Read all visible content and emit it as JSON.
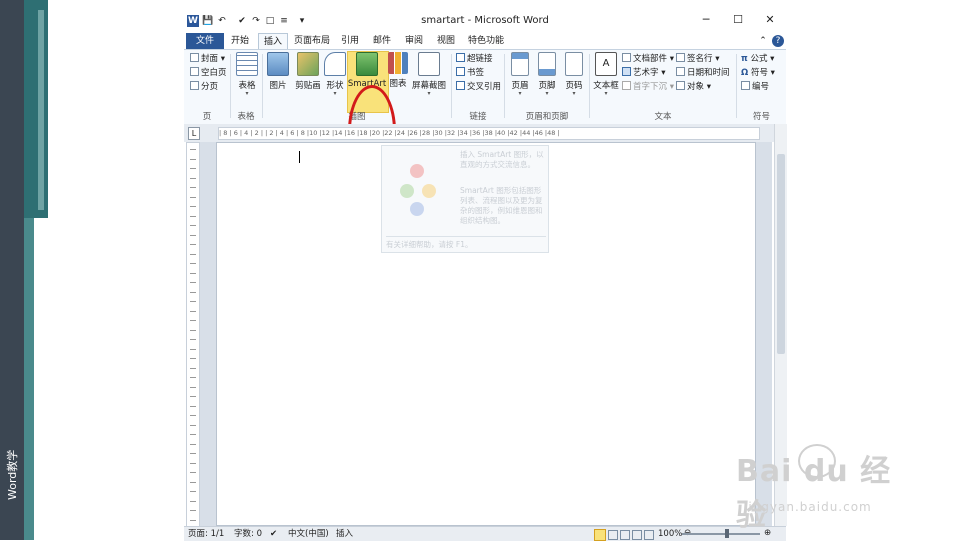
{
  "side": {
    "label": "Word教学"
  },
  "window": {
    "title": "smartart - Microsoft Word",
    "qat": [
      "W",
      "💾",
      "↶",
      "✔",
      "↷",
      "□",
      "≡",
      "▾"
    ],
    "controls": {
      "minimize": "─",
      "maximize": "☐",
      "close": "✕"
    }
  },
  "tabs": {
    "file": "文件",
    "home": "开始",
    "insert": "插入",
    "layout": "页面布局",
    "references": "引用",
    "mailings": "邮件",
    "review": "审阅",
    "view": "视图",
    "addins": "特色功能",
    "help_min": "⌃",
    "help": "?"
  },
  "ribbon": {
    "pages": {
      "cover": "封面",
      "blank": "空白页",
      "break": "分页",
      "label": "页"
    },
    "tables": {
      "table": "表格",
      "label": "表格"
    },
    "illustrations": {
      "picture": "图片",
      "clipart": "剪贴画",
      "shapes": "形状",
      "smartart": "SmartArt",
      "chart": "图表",
      "screenshot": "屏幕截图",
      "label": "插图"
    },
    "links": {
      "hyperlink": "超链接",
      "bookmark": "书签",
      "crossref": "交叉引用",
      "label": "链接"
    },
    "header_footer": {
      "header": "页眉",
      "footer": "页脚",
      "pagenum": "页码",
      "label": "页眉和页脚"
    },
    "text": {
      "textbox": "文本框",
      "quickparts": "文档部件",
      "wordart": "艺术字",
      "dropcap": "首字下沉",
      "signature": "签名行",
      "datetime": "日期和时间",
      "object": "对象",
      "label": "文本"
    },
    "symbols": {
      "equation": "公式",
      "symbol": "符号",
      "number": "编号",
      "label": "符号"
    }
  },
  "ruler": {
    "text": "| 8 | 6 | 4 | 2 |  | 2 | 4 | 6 | 8 |10 |12 |14 |16 |18 |20 |22 |24 |26 |28 |30 |32 |34 |36 |38 |40 |42 |44 |46 |48 |"
  },
  "tooltip": {
    "line1": "插入 SmartArt 图形，以直观的方式交流信息。",
    "line2": "SmartArt 图形包括图形列表、流程图以及更为复杂的图形，例如维恩图和组织结构图。",
    "help": "有关详细帮助，请按 F1。"
  },
  "status": {
    "page": "页面: 1/1",
    "words": "字数: 0",
    "lang": "中文(中国)",
    "mode": "插入",
    "zoom": "100%",
    "zoom_level": 0.58
  },
  "watermark": {
    "brand": "Bai  du 经验",
    "url": "jingyan.baidu.com"
  },
  "colors": {
    "file_tab": "#2b5797",
    "highlight": "#f9e27a",
    "annotation": "#d21a1a"
  }
}
